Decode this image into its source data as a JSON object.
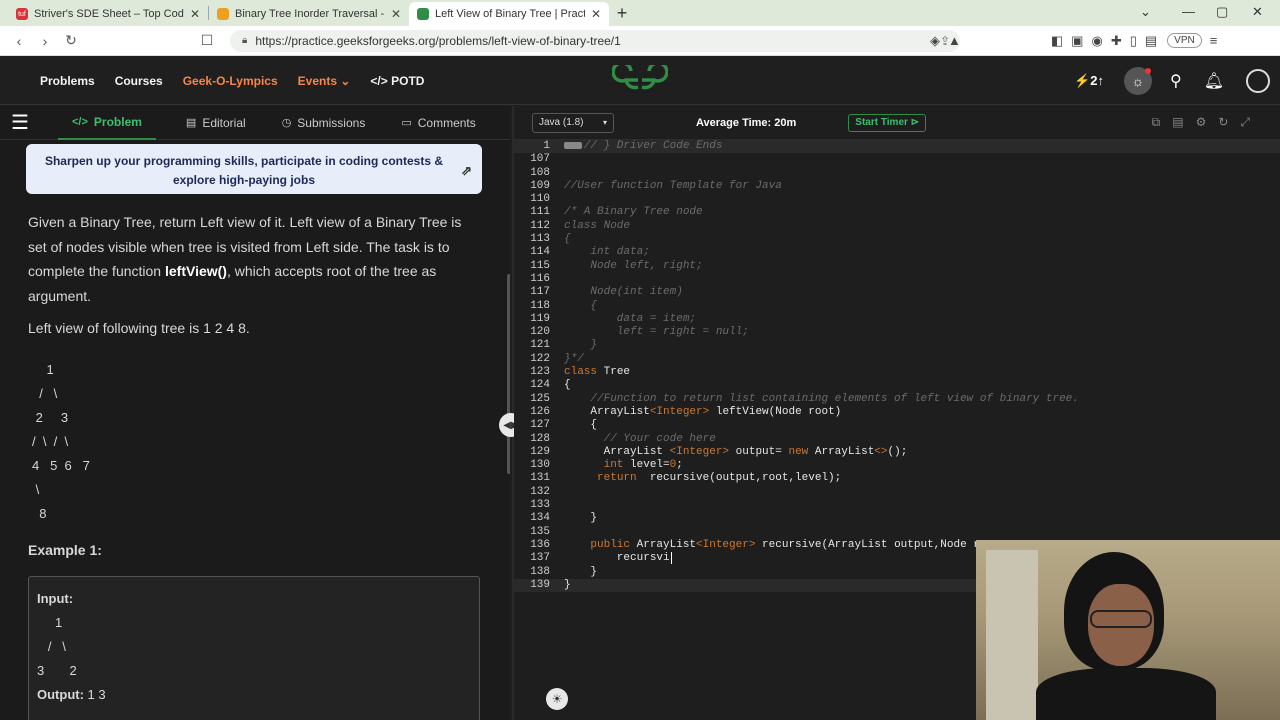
{
  "browser": {
    "tabs": [
      {
        "title": "Striver's SDE Sheet – Top Coding Intervi",
        "icon_color": "#d9323b",
        "icon_text": "tuf"
      },
      {
        "title": "Binary Tree Inorder Traversal - LeetCod",
        "icon_color": "#f0a020",
        "icon_text": ""
      },
      {
        "title": "Left View of Binary Tree | Practice | Ge",
        "icon_color": "#2f8d46",
        "icon_text": ""
      }
    ],
    "url": "https://practice.geeksforgeeks.org/problems/left-view-of-binary-tree/1",
    "vpn_label": "VPN"
  },
  "site": {
    "nav": [
      "Problems",
      "Courses",
      "Geek-O-Lympics",
      "Events",
      "POTD"
    ],
    "streak": "2",
    "brand_color": "#2f8d46"
  },
  "problem": {
    "tabs": [
      "Problem",
      "Editorial",
      "Submissions",
      "Comments"
    ],
    "banner": "Sharpen up your programming skills, participate in coding contests & explore high-paying jobs",
    "desc_pre": "Given a Binary Tree, return Left view of it. Left view of a Binary Tree is set of nodes visible when tree is visited from Left side. The task is to complete the function ",
    "desc_fn": "leftView()",
    "desc_post": ", which accepts root of the tree as argument.",
    "left_view_text": "Left view of following tree is 1 2 4 8.",
    "tree_lines": [
      "    1",
      "  /   \\",
      " 2     3",
      "/  \\  /  \\",
      "4   5  6   7",
      " \\",
      "  8"
    ],
    "example_title": "Example 1:",
    "example_input_label": "Input:",
    "example_tree_lines": [
      "     1",
      "   /   \\",
      "3       2"
    ],
    "example_output_label": "Output:",
    "example_output_value": "1 3"
  },
  "editor": {
    "language": "Java (1.8)",
    "avg_time": "Average Time: 20m",
    "timer_label": "Start Timer",
    "lines": [
      {
        "n": "1",
        "t": "   // } Driver Code Ends",
        "cls": "c-com",
        "fold": true
      },
      {
        "n": "107",
        "t": "",
        "cls": ""
      },
      {
        "n": "108",
        "t": "",
        "cls": ""
      },
      {
        "n": "109",
        "t": "//User function Template for Java",
        "cls": "c-com"
      },
      {
        "n": "110",
        "t": "",
        "cls": ""
      },
      {
        "n": "111",
        "t": "/* A Binary Tree node",
        "cls": "c-com"
      },
      {
        "n": "112",
        "t": "class Node",
        "cls": "c-com"
      },
      {
        "n": "113",
        "t": "{",
        "cls": "c-com"
      },
      {
        "n": "114",
        "t": "    int data;",
        "cls": "c-com"
      },
      {
        "n": "115",
        "t": "    Node left, right;",
        "cls": "c-com"
      },
      {
        "n": "116",
        "t": "",
        "cls": ""
      },
      {
        "n": "117",
        "t": "    Node(int item)",
        "cls": "c-com"
      },
      {
        "n": "118",
        "t": "    {",
        "cls": "c-com"
      },
      {
        "n": "119",
        "t": "        data = item;",
        "cls": "c-com"
      },
      {
        "n": "120",
        "t": "        left = right = null;",
        "cls": "c-com"
      },
      {
        "n": "121",
        "t": "    }",
        "cls": "c-com"
      },
      {
        "n": "122",
        "t": "}*/",
        "cls": "c-com"
      },
      {
        "n": "123",
        "t": "class Tree",
        "cls": "kw-class"
      },
      {
        "n": "124",
        "t": "{",
        "cls": ""
      },
      {
        "n": "125",
        "t": "    //Function to return list containing elements of left view of binary tree.",
        "cls": "c-com"
      },
      {
        "n": "126",
        "t": "    ArrayList<Integer> leftView(Node root)",
        "cls": "gen"
      },
      {
        "n": "127",
        "t": "    {",
        "cls": ""
      },
      {
        "n": "128",
        "t": "      // Your code here",
        "cls": "c-com"
      },
      {
        "n": "129",
        "t": "      ArrayList <Integer> output= new ArrayList<>();",
        "cls": "gen2"
      },
      {
        "n": "130",
        "t": "      int level=0;",
        "cls": "int"
      },
      {
        "n": "131",
        "t": "     return  recursive(output,root,level);",
        "cls": "ret"
      },
      {
        "n": "132",
        "t": "",
        "cls": ""
      },
      {
        "n": "133",
        "t": "",
        "cls": ""
      },
      {
        "n": "134",
        "t": "    }",
        "cls": ""
      },
      {
        "n": "135",
        "t": "",
        "cls": ""
      },
      {
        "n": "136",
        "t": "    public ArrayList<Integer> recursive(ArrayList output,Node roo",
        "cls": "pub"
      },
      {
        "n": "137",
        "t": "        recursvi",
        "cls": "cursor"
      },
      {
        "n": "138",
        "t": "    }",
        "cls": ""
      },
      {
        "n": "139",
        "t": "}",
        "cls": "hl"
      }
    ]
  }
}
